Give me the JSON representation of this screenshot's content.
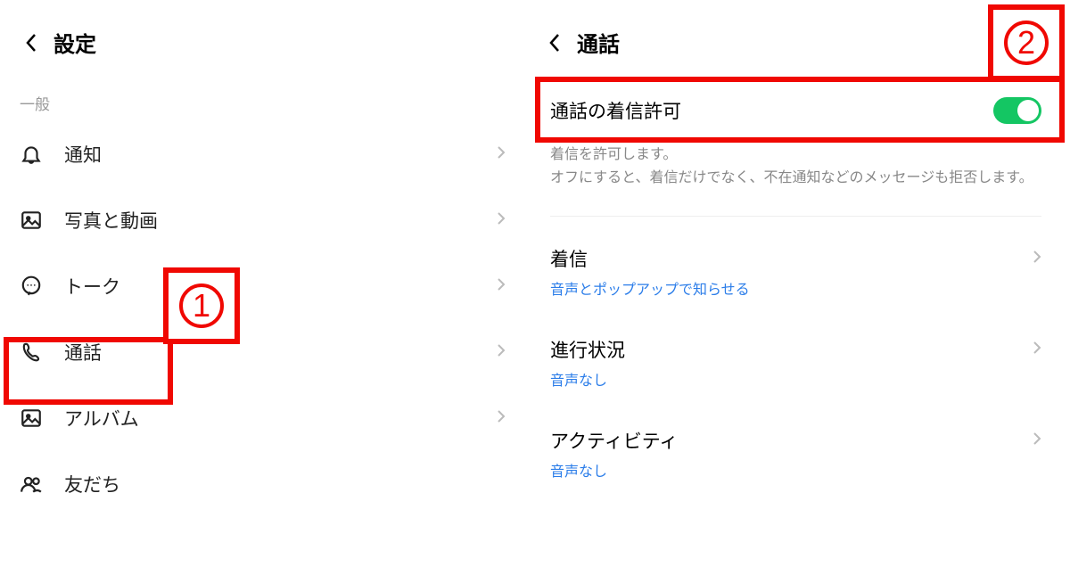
{
  "left": {
    "title": "設定",
    "section_general": "一般",
    "items": [
      {
        "icon": "bell",
        "label": "通知"
      },
      {
        "icon": "image",
        "label": "写真と動画"
      },
      {
        "icon": "chat",
        "label": "トーク"
      },
      {
        "icon": "phone",
        "label": "通話"
      },
      {
        "icon": "image",
        "label": "アルバム"
      },
      {
        "icon": "friends",
        "label": "友だち"
      }
    ]
  },
  "right": {
    "title": "通話",
    "toggle_label": "通話の着信許可",
    "toggle_on": true,
    "description_line1": "着信を許可します。",
    "description_line2": "オフにすると、着信だけでなく、不在通知などのメッセージも拒否します。",
    "items": [
      {
        "label": "着信",
        "detail": "音声とポップアップで知らせる"
      },
      {
        "label": "進行状況",
        "detail": "音声なし"
      },
      {
        "label": "アクティビティ",
        "detail": "音声なし"
      }
    ]
  },
  "annotations": {
    "badge1": "1",
    "badge2": "2"
  }
}
